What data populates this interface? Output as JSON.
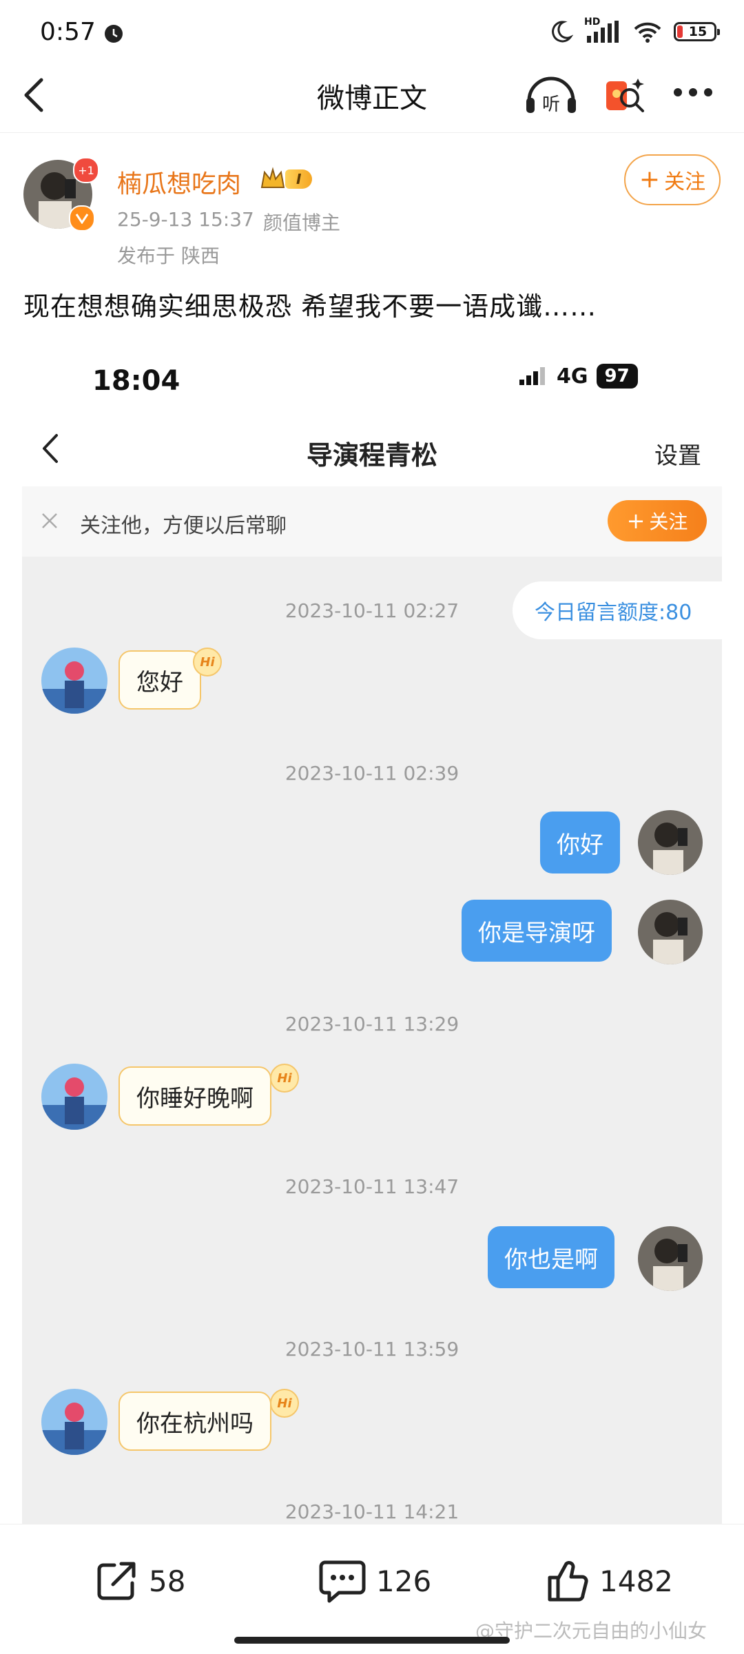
{
  "status_bar": {
    "time": "0:57",
    "network": "HD",
    "battery": "15"
  },
  "nav": {
    "title": "微博正文"
  },
  "post": {
    "author": "楠瓜想吃肉",
    "avatar_badge": "+1",
    "rank_badge": "I",
    "date": "25-9-13 15:37",
    "tag": "颜值博主",
    "location": "发布于 陕西",
    "follow_label": "关注",
    "text": "现在想想确实细思极恐 希望我不要一语成谶……"
  },
  "embedded": {
    "time": "18:04",
    "network": "4G",
    "battery": "97",
    "title": "导演程青松",
    "settings": "设置",
    "notice_text": "关注他，方便以后常聊",
    "notice_follow": "关注",
    "quota": "今日留言额度:80",
    "hi_badge": "Hi",
    "messages": [
      {
        "kind": "time",
        "text": "2023-10-11 02:27"
      },
      {
        "kind": "left",
        "text": "您好"
      },
      {
        "kind": "time",
        "text": "2023-10-11 02:39"
      },
      {
        "kind": "right",
        "text": "你好"
      },
      {
        "kind": "right",
        "text": "你是导演呀"
      },
      {
        "kind": "time",
        "text": "2023-10-11 13:29"
      },
      {
        "kind": "left",
        "text": "你睡好晚啊"
      },
      {
        "kind": "time",
        "text": "2023-10-11 13:47"
      },
      {
        "kind": "right",
        "text": "你也是啊"
      },
      {
        "kind": "time",
        "text": "2023-10-11 13:59"
      },
      {
        "kind": "left",
        "text": "你在杭州吗"
      },
      {
        "kind": "time",
        "text": "2023-10-11 14:21"
      }
    ]
  },
  "actions": {
    "repost": "58",
    "comment": "126",
    "like": "1482"
  },
  "watermark": "@守护二次元自由的小仙女",
  "colors": {
    "accent": "#f07a11",
    "bubble_blue": "#4a9eef",
    "username": "#e8761a"
  }
}
